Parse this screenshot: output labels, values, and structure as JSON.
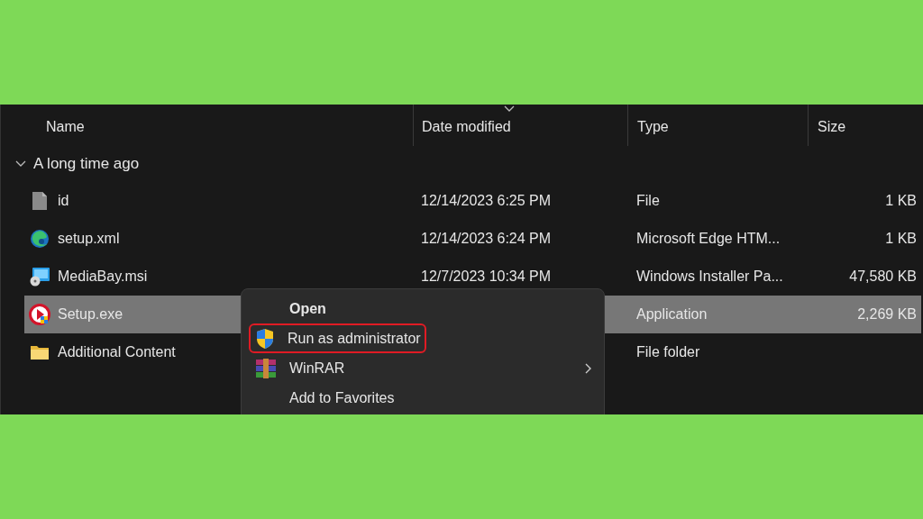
{
  "columns": [
    {
      "label": "Name",
      "sorted": false
    },
    {
      "label": "Date modified",
      "sorted": true
    },
    {
      "label": "Type",
      "sorted": false
    },
    {
      "label": "Size",
      "sorted": false
    }
  ],
  "group": {
    "label": "A long time ago",
    "expanded": true
  },
  "files": [
    {
      "kind": "file",
      "name": "id",
      "date": "12/14/2023 6:25 PM",
      "type": "File",
      "size": "1 KB",
      "selected": false
    },
    {
      "kind": "edge",
      "name": "setup.xml",
      "date": "12/14/2023 6:24 PM",
      "type": "Microsoft Edge HTM...",
      "size": "1 KB",
      "selected": false
    },
    {
      "kind": "msi",
      "name": "MediaBay.msi",
      "date": "12/7/2023 10:34 PM",
      "type": "Windows Installer Pa...",
      "size": "47,580 KB",
      "selected": false
    },
    {
      "kind": "exe",
      "name": "Setup.exe",
      "type": "Application",
      "size": "2,269 KB",
      "selected": true
    },
    {
      "kind": "folder",
      "name": "Additional Content",
      "type": "File folder",
      "selected": false
    }
  ],
  "context_menu": [
    {
      "kind": "none",
      "label": "Open",
      "default": true,
      "highlighted": false,
      "submenu": false
    },
    {
      "kind": "shield",
      "label": "Run as administrator",
      "default": false,
      "highlighted": true,
      "submenu": false
    },
    {
      "kind": "winrar",
      "label": "WinRAR",
      "default": false,
      "highlighted": false,
      "submenu": true
    },
    {
      "kind": "none",
      "label": "Add to Favorites",
      "default": false,
      "highlighted": false,
      "submenu": false
    }
  ]
}
